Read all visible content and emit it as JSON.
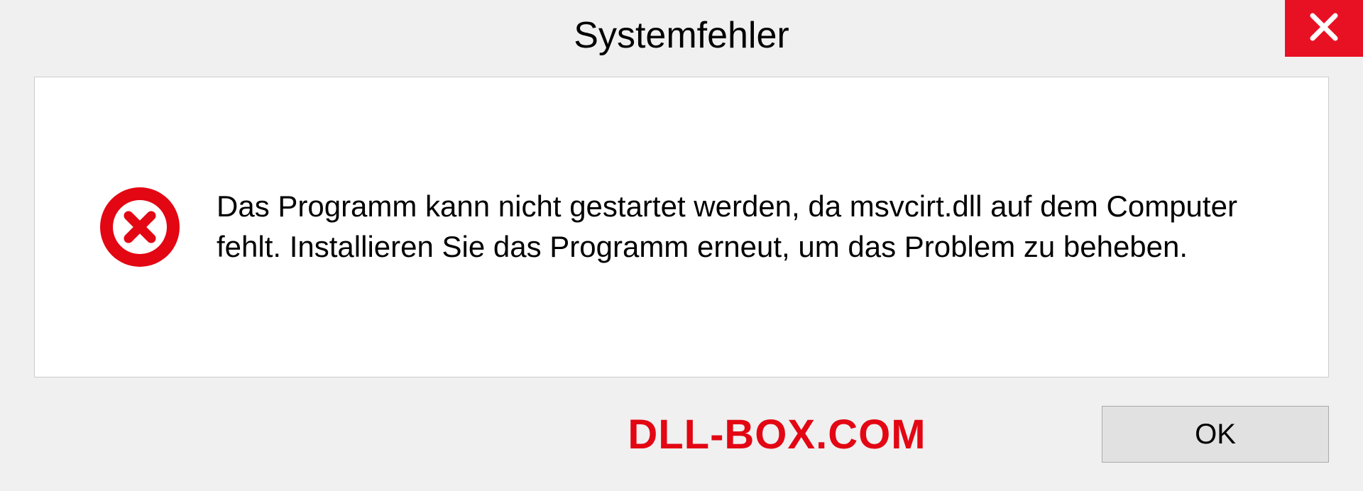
{
  "dialog": {
    "title": "Systemfehler",
    "message": "Das Programm kann nicht gestartet werden, da msvcirt.dll auf dem Computer fehlt. Installieren Sie das Programm erneut, um das Problem zu beheben.",
    "ok_label": "OK"
  },
  "watermark": "DLL-BOX.COM"
}
